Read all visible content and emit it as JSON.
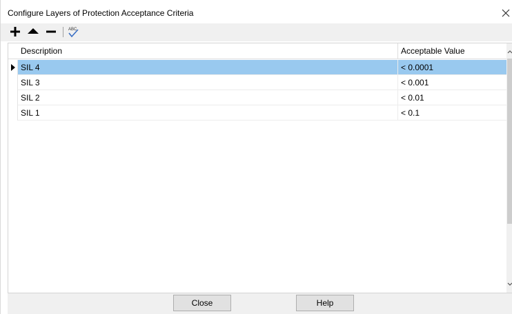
{
  "window": {
    "title": "Configure Layers of Protection Acceptance Criteria"
  },
  "toolbar": {
    "add_icon": "plus-icon",
    "move_up_icon": "triangle-up-icon",
    "remove_icon": "minus-icon",
    "spellcheck_icon": "abc-check-icon"
  },
  "grid": {
    "columns": [
      "Description",
      "Acceptable Value"
    ],
    "rows": [
      {
        "description": "SIL 4",
        "value": "< 0.0001",
        "selected": true
      },
      {
        "description": "SIL 3",
        "value": "< 0.001",
        "selected": false
      },
      {
        "description": "SIL 2",
        "value": "< 0.01",
        "selected": false
      },
      {
        "description": "SIL 1",
        "value": "< 0.1",
        "selected": false
      }
    ]
  },
  "buttons": {
    "close_label": "Close",
    "help_label": "Help"
  },
  "colors": {
    "selection": "#99c9ef",
    "toolbar_bg": "#f0f0f0"
  }
}
